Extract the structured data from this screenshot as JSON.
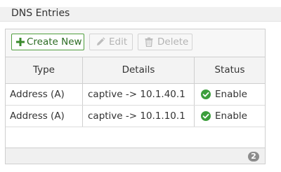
{
  "section": {
    "title": "DNS Entries"
  },
  "toolbar": {
    "create_label": "Create New",
    "edit_label": "Edit",
    "delete_label": "Delete"
  },
  "table": {
    "columns": [
      "Type",
      "Details",
      "Status"
    ],
    "rows": [
      {
        "type": "Address (A)",
        "details": "captive -> 10.1.40.1",
        "status": "Enable"
      },
      {
        "type": "Address (A)",
        "details": "captive -> 10.1.10.1",
        "status": "Enable"
      }
    ],
    "count": "2"
  },
  "icons": {
    "create": "plus-icon",
    "edit": "pencil-icon",
    "delete": "trash-icon",
    "status": "check-circle-icon"
  },
  "colors": {
    "accent_green": "#4f9e3e",
    "status_green": "#3c9e3c",
    "disabled_text": "#b4b4b4"
  }
}
